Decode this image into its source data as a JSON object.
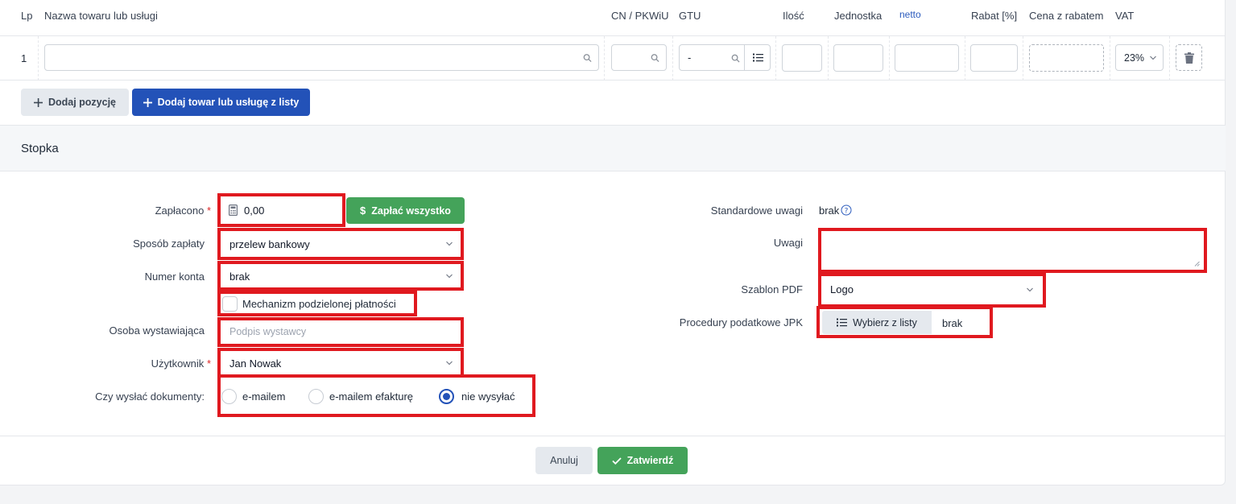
{
  "table": {
    "headers": {
      "lp": "Lp",
      "name": "Nazwa towaru lub usługi",
      "cn": "CN / PKWiU",
      "gtu": "GTU",
      "qty": "Ilość",
      "unit": "Jednostka",
      "netto": "netto",
      "discount": "Rabat [%]",
      "price_discount": "Cena z rabatem",
      "vat": "VAT"
    },
    "rows": [
      {
        "lp": "1",
        "name": "",
        "cn": "",
        "gtu": "-",
        "qty": "",
        "unit": "",
        "netto": "",
        "discount": "",
        "price_discount": "",
        "vat": "23%"
      }
    ],
    "add_position_label": "Dodaj pozycję",
    "add_from_list_label": "Dodaj towar lub usługę z listy"
  },
  "footer_section": {
    "title": "Stopka",
    "paid": {
      "label": "Zapłacono",
      "value": "0,00",
      "pay_all_label": "Zapłać wszystko"
    },
    "payment_method": {
      "label": "Sposób zapłaty",
      "value": "przelew bankowy"
    },
    "account_number": {
      "label": "Numer konta",
      "value": "brak"
    },
    "split_payment_label": "Mechanizm podzielonej płatności",
    "issuer": {
      "label": "Osoba wystawiająca",
      "placeholder": "Podpis wystawcy"
    },
    "user": {
      "label": "Użytkownik",
      "value": "Jan Nowak"
    },
    "send_docs": {
      "label": "Czy wysłać dokumenty:",
      "options": [
        "e-mailem",
        "e-mailem efakturę",
        "nie wysyłać"
      ],
      "selected": "nie wysyłać"
    },
    "standard_notes": {
      "label": "Standardowe uwagi",
      "value": "brak"
    },
    "notes": {
      "label": "Uwagi",
      "value": ""
    },
    "pdf_template": {
      "label": "Szablon PDF",
      "value": "Logo"
    },
    "jpk": {
      "label": "Procedury podatkowe JPK",
      "button_label": "Wybierz z listy",
      "value": "brak"
    }
  },
  "actions": {
    "cancel_label": "Anuluj",
    "confirm_label": "Zatwierdź"
  },
  "colors": {
    "primary": "#2352b8",
    "success": "#44a35a",
    "highlight": "#e0191f"
  }
}
